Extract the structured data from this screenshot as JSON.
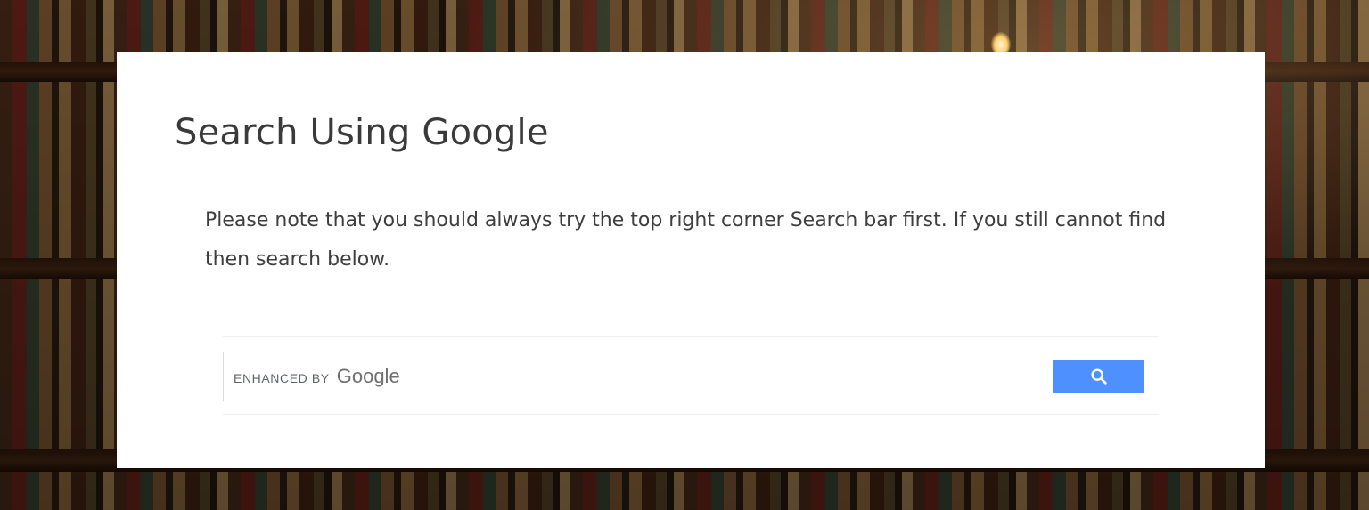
{
  "page": {
    "title": "Search Using Google",
    "note": "Please note that you should always try the top right corner Search bar first. If you still cannot find then search below."
  },
  "search": {
    "value": "",
    "placeholder": "",
    "brand_prefix": "ENHANCED BY",
    "brand_name": "Google",
    "button_icon": "search-icon",
    "button_color": "#4d90fe"
  },
  "colors": {
    "card_background": "#ffffff",
    "title_text": "#3a3a3a",
    "body_text": "#3e3e3e"
  }
}
